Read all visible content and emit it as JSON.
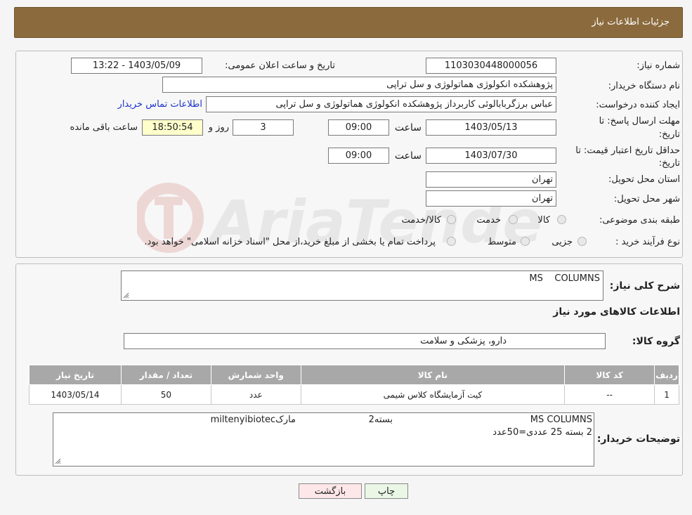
{
  "header": {
    "title": "جزئیات اطلاعات نیاز"
  },
  "form": {
    "need_number_label": "شماره نیاز:",
    "need_number": "1103030448000056",
    "announce_label": "تاریخ و ساعت اعلان عمومی:",
    "announce_value": "1403/05/09 - 13:22",
    "buyer_org_label": "نام دستگاه خریدار:",
    "buyer_org": "پژوهشکده انکولوژی هماتولوژی و سل تراپی",
    "creator_label": "ایجاد کننده درخواست:",
    "creator": "عباس برزگربابالوئی کاربرداز پژوهشکده انکولوژی هماتولوژی و سل تراپی",
    "contact_link": "اطلاعات تماس خریدار",
    "deadline_label_1": "مهلت ارسال پاسخ: تا",
    "deadline_label_2": "تاریخ:",
    "deadline_date": "1403/05/13",
    "time_label": "ساعت",
    "deadline_time": "09:00",
    "days_value": "3",
    "days_label": "روز و",
    "remaining_time": "18:50:54",
    "remaining_label": "ساعت باقی مانده",
    "validity_label_1": "حداقل تاریخ اعتبار قیمت: تا",
    "validity_label_2": "تاریخ:",
    "validity_date": "1403/07/30",
    "validity_time": "09:00",
    "province_label": "استان محل تحویل:",
    "province": "تهران",
    "city_label": "شهر محل تحویل:",
    "city": "تهران",
    "category_label": "طبقه بندی موضوعی:",
    "category_options": [
      "کالا",
      "خدمت",
      "کالا/خدمت"
    ],
    "process_label": "نوع فرآیند خرید :",
    "process_options": [
      "جزیی",
      "متوسط"
    ],
    "process_note": "پرداخت تمام یا بخشی از مبلغ خرید،از محل \"اسناد خزانه اسلامی\" خواهد بود."
  },
  "watermark": {
    "text": "AriaTender.neT"
  },
  "summary": {
    "desc_label": "شرح کلی نیاز:",
    "desc_value": "MS    COLUMNS",
    "goods_title": "اطلاعات کالاهای مورد نیاز",
    "group_label": "گروه کالا:",
    "group_value": "دارو، پزشکی و سلامت"
  },
  "table": {
    "headers": [
      "ردیف",
      "کد کالا",
      "نام کالا",
      "واحد شمارش",
      "تعداد / مقدار",
      "تاریخ نیاز"
    ],
    "rows": [
      [
        "1",
        "--",
        "کیت آزمایشگاه کلاس شیمی",
        "عدد",
        "50",
        "1403/05/14"
      ]
    ]
  },
  "buyer_notes": {
    "label": "توضیحات خریدار:",
    "line1_a": "MS COLUMNS",
    "line1_b": "بسته2",
    "line1_c": "مارکmiltenyibiotec",
    "line2": "2 بسته 25 عددی=50عدد"
  },
  "buttons": {
    "print": "چاپ",
    "back": "بازگشت"
  }
}
